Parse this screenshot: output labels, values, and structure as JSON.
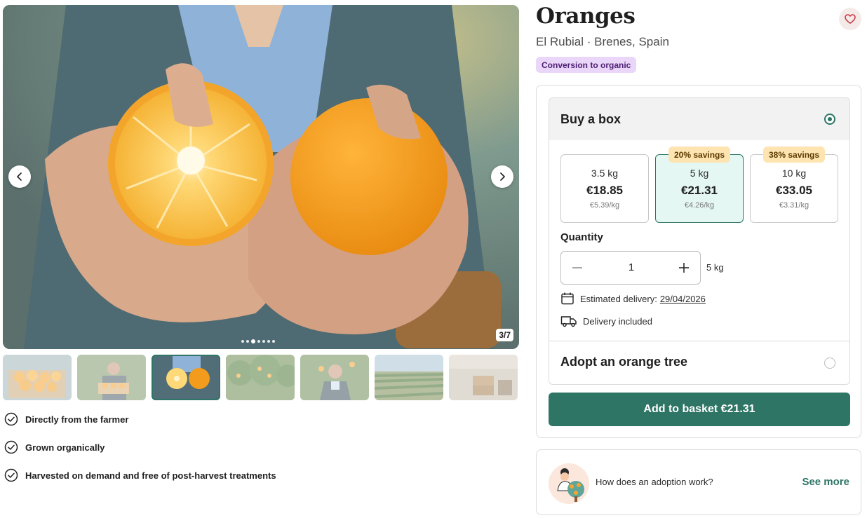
{
  "product": {
    "title": "Oranges",
    "farm": "El Rubial",
    "location": "Brenes, Spain",
    "subtitle": "El Rubial · Brenes, Spain",
    "badge": "Conversion to organic"
  },
  "gallery": {
    "counter": "3/7",
    "current": 3,
    "total": 7,
    "thumbnails": [
      {
        "subject": "orange crate"
      },
      {
        "subject": "farmer with box"
      },
      {
        "subject": "halved orange in hands"
      },
      {
        "subject": "orange trees"
      },
      {
        "subject": "farmer portrait"
      },
      {
        "subject": "orchard rows"
      },
      {
        "subject": "packing shed"
      }
    ]
  },
  "features": [
    "Directly from the farmer",
    "Grown organically",
    "Harvested on demand and free of post-harvest treatments"
  ],
  "purchase": {
    "buy_box_label": "Buy a box",
    "box_options": [
      {
        "weight": "3.5 kg",
        "price": "€18.85",
        "unit_price": "€5.39/kg",
        "savings": ""
      },
      {
        "weight": "5 kg",
        "price": "€21.31",
        "unit_price": "€4.26/kg",
        "savings": "20% savings"
      },
      {
        "weight": "10 kg",
        "price": "€33.05",
        "unit_price": "€3.31/kg",
        "savings": "38% savings"
      }
    ],
    "selected_box": 1,
    "quantity_label": "Quantity",
    "quantity": "1",
    "quantity_unit": "5 kg",
    "delivery_estimate_label": "Estimated delivery:",
    "delivery_date": "29/04/2026",
    "delivery_included": "Delivery included",
    "adopt_label": "Adopt an orange tree",
    "add_to_basket": "Add to basket €21.31"
  },
  "adoption": {
    "question": "How does an adoption work?",
    "see_more": "See more"
  },
  "colors": {
    "accent": "#2e7566",
    "badge_bg": "#ead6f9",
    "savings_bg": "#fde4b0",
    "selected_bg": "#e4f7f3"
  },
  "icons": {
    "prev": "chevron-left-icon",
    "next": "chevron-right-icon",
    "favorite": "heart-icon",
    "feature": "check-circle-icon",
    "calendar": "calendar-icon",
    "delivery": "truck-icon",
    "minus": "minus-icon",
    "plus": "plus-icon"
  }
}
